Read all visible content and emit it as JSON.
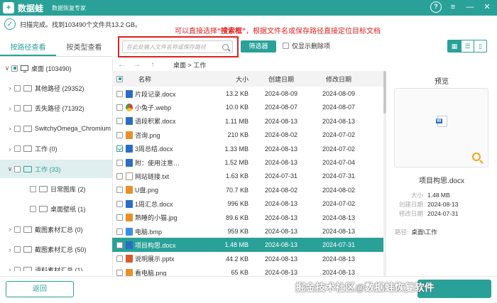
{
  "app": {
    "name": "数据蛙",
    "subtitle": "数据恢复专家",
    "logo_glyph": "+"
  },
  "titlebar_icons": [
    "help-icon",
    "menu-icon",
    "minimize-icon",
    "close-icon"
  ],
  "titlebar_glyphs": {
    "help": "?",
    "menu": "≡",
    "minimize": "—",
    "close": "✕"
  },
  "scan": {
    "status": "扫描完成。找到103490个文件共13.2 GB。"
  },
  "annotation": {
    "prefix": "可以直接选择",
    "quoted": "“搜索框”",
    "suffix": "，根据文件名或保存路径直接定位目标文档"
  },
  "tabs": [
    {
      "label": "按路径查看",
      "active": true
    },
    {
      "label": "按类型查看",
      "active": false
    }
  ],
  "search": {
    "placeholder": "在此处输入文件名称或保存路径"
  },
  "filter_button": "筛选器",
  "only_deleted_label": "仅显示删除项",
  "tree": [
    {
      "label": "桌面 (103490)",
      "level": 0,
      "chevron": "∨",
      "icon": "monitor"
    },
    {
      "label": "其他路径 (29352)",
      "level": 1,
      "chevron": "›",
      "icon": "folder"
    },
    {
      "label": "丢失路径 (71392)",
      "level": 1,
      "chevron": "›",
      "icon": "folder"
    },
    {
      "label": "SwitchyOmega_Chromium",
      "level": 1,
      "chevron": "›",
      "icon": "folder"
    },
    {
      "label": "工作 (0)",
      "level": 1,
      "chevron": "›",
      "icon": "folder"
    },
    {
      "label": "工作 (33)",
      "level": 1,
      "chevron": "∨",
      "icon": "folder",
      "selected": true
    },
    {
      "label": "日常图库 (2)",
      "level": 2,
      "chevron": "",
      "icon": "folder"
    },
    {
      "label": "桌面壁纸 (1)",
      "level": 2,
      "chevron": "",
      "icon": "folder"
    },
    {
      "label": "截图素材汇总 (0)",
      "level": 1,
      "chevron": "›",
      "icon": "folder"
    },
    {
      "label": "截图素材汇总 (50)",
      "level": 1,
      "chevron": "›",
      "icon": "folder"
    },
    {
      "label": "语料素材汇总 (1)",
      "level": 1,
      "chevron": "›",
      "icon": "folder"
    }
  ],
  "nav": {
    "back": "←",
    "forward": "→",
    "up": "↑",
    "path": "桌面 > 工作"
  },
  "columns": {
    "name": "名称",
    "size": "大小",
    "created": "创建日期",
    "modified": "修改日期"
  },
  "files": [
    {
      "name": "片段记录.docx",
      "size": "13.2 KB",
      "created": "2024-08-09",
      "modified": "2024-08-09",
      "type": "doc",
      "checked": false
    },
    {
      "name": "小兔子.webp",
      "size": "10.0 KB",
      "created": "2024-08-07",
      "modified": "2024-08-07",
      "type": "web",
      "checked": false
    },
    {
      "name": "语段积累.docx",
      "size": "1.11 MB",
      "created": "2024-08-13",
      "modified": "2024-08-13",
      "type": "doc",
      "checked": false
    },
    {
      "name": "咨询.png",
      "size": "210 KB",
      "created": "2024-08-02",
      "modified": "2024-07-02",
      "type": "img",
      "checked": false
    },
    {
      "name": "3周总结.docx",
      "size": "1.33 MB",
      "created": "2024-08-13",
      "modified": "2024-07-02",
      "type": "doc",
      "checked": true
    },
    {
      "name": "附：使用注意…",
      "size": "1.52 MB",
      "created": "2024-08-13",
      "modified": "2024-07-04",
      "type": "doc",
      "checked": false
    },
    {
      "name": "网站链接.txt",
      "size": "1.63 KB",
      "created": "2024-07-31",
      "modified": "2024-07-31",
      "type": "txt",
      "checked": false
    },
    {
      "name": "U盘.png",
      "size": "70.7 KB",
      "created": "2024-08-02",
      "modified": "2024-08-02",
      "type": "img",
      "checked": false
    },
    {
      "name": "1周汇总.docx",
      "size": "996 KB",
      "created": "2024-08-13",
      "modified": "2024-07-02",
      "type": "doc",
      "checked": false
    },
    {
      "name": "熟睡的小猫.jpg",
      "size": "89.6 KB",
      "created": "2024-08-13",
      "modified": "2024-08-13",
      "type": "img",
      "checked": false
    },
    {
      "name": "电脑.bmp",
      "size": "959 KB",
      "created": "2024-08-13",
      "modified": "2024-08-13",
      "type": "bmp",
      "checked": false
    },
    {
      "name": "项目构思.docx",
      "size": "1.48 MB",
      "created": "2024-08-13",
      "modified": "2024-07-31",
      "type": "doc",
      "checked": false,
      "selected": true
    },
    {
      "name": "说明展示.pptx",
      "size": "44.2 KB",
      "created": "2024-08-13",
      "modified": "2024-08-13",
      "type": "ppt",
      "checked": false
    },
    {
      "name": "看电脑.png",
      "size": "65 KB",
      "created": "2024-08-13",
      "modified": "2024-08-13",
      "type": "img",
      "checked": false
    }
  ],
  "preview": {
    "title": "预览",
    "filename": "项目构思.docx",
    "size_label": "大小",
    "size": "1.48 MB",
    "created_label": "创建日期",
    "created": "2024-08-13",
    "modified_label": "修改日期",
    "modified": "2024-07-31",
    "path_label": "路径:",
    "path": "桌面\\工作"
  },
  "back_button": "返回",
  "watermark": "掘金技术社区@数据蛙恢复软件",
  "colors": {
    "accent": "#2aa198",
    "annotation": "#e02020",
    "selected_row": "#2aa198"
  }
}
